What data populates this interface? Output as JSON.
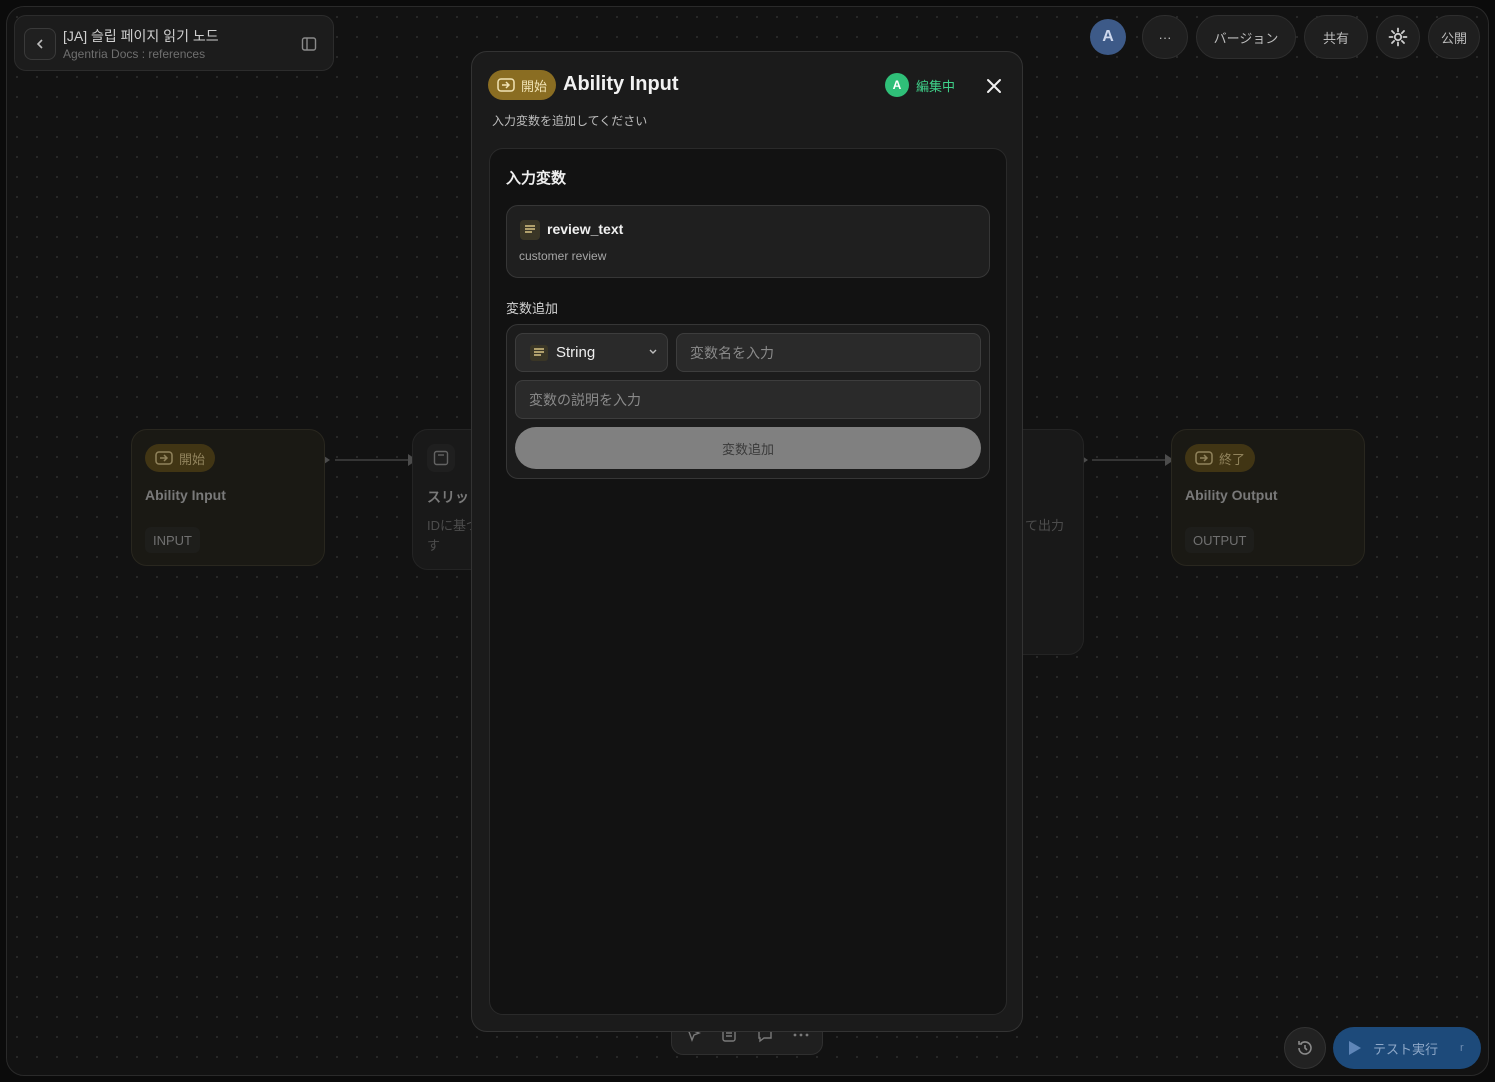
{
  "header": {
    "title": "[JA] 슬립 페이지 읽기 노드",
    "subtitle": "Agentria Docs : references"
  },
  "toolbar": {
    "avatar_letter": "A",
    "more": "···",
    "version": "バージョン",
    "share": "共有",
    "publish": "公開"
  },
  "nodes": {
    "start": {
      "chip": "開始",
      "title": "Ability Input",
      "tag": "INPUT"
    },
    "middle": {
      "chip_partial": "ス",
      "title_partial": "スリッ",
      "desc_partial_1": "IDに基づ",
      "desc_partial_2": "す"
    },
    "right_partial": {
      "desc_partial": "て出力"
    },
    "end": {
      "chip": "終了",
      "title": "Ability Output",
      "tag": "OUTPUT"
    }
  },
  "modal": {
    "chip": "開始",
    "title": "Ability Input",
    "editing_avatar": "A",
    "editing_label": "編集中",
    "subtitle": "入力変数を追加してください",
    "section_title": "入力変数",
    "variables": [
      {
        "name": "review_text",
        "description": "customer review"
      }
    ],
    "add_section_label": "変数追加",
    "type_select": "String",
    "name_placeholder": "変数名を入力",
    "desc_placeholder": "変数の説明を入力",
    "add_button": "変数追加"
  },
  "bottom": {
    "run_label": "テスト実行",
    "run_shortcut": "r"
  },
  "colors": {
    "accent_start": "#8a6d22",
    "editing_green": "#2fbf78",
    "run_blue": "#1d4a7a"
  }
}
